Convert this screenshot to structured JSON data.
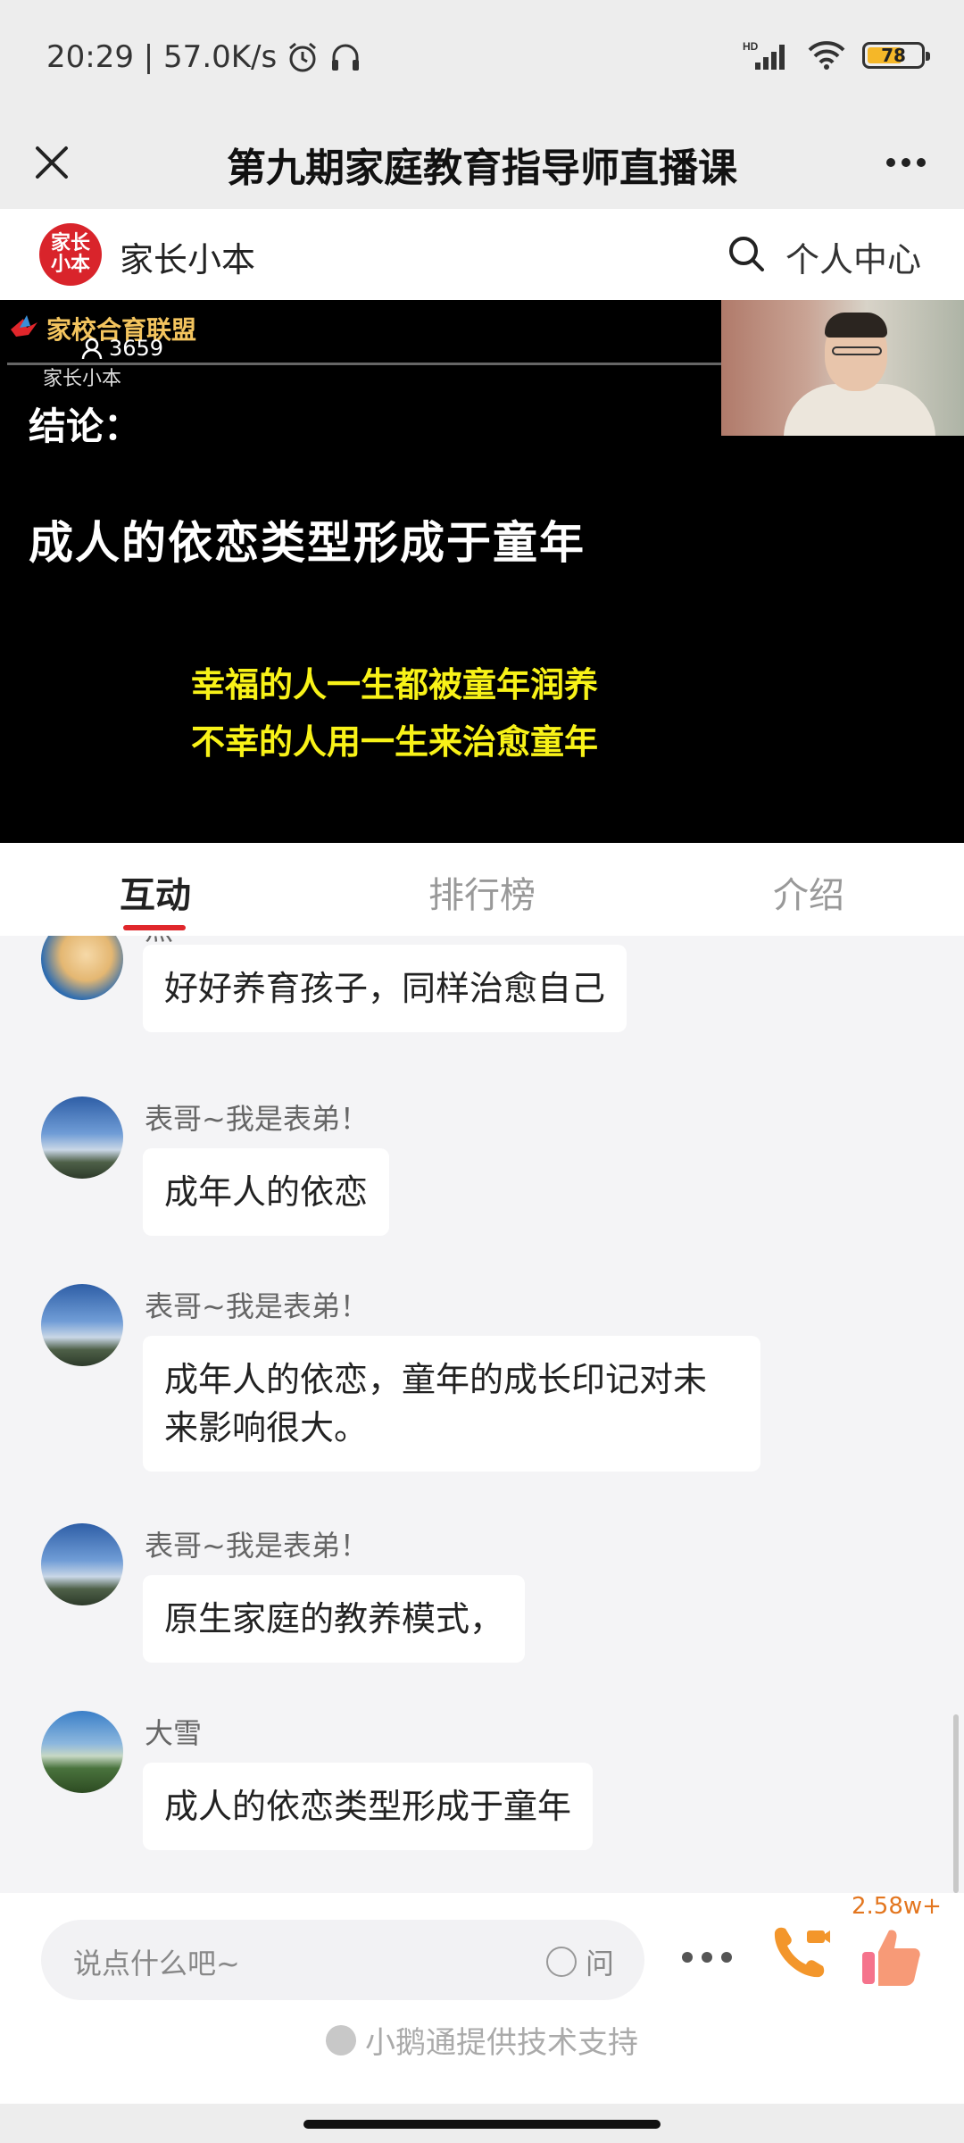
{
  "status_bar": {
    "time_speed": "20:29 | 57.0K/s",
    "network": "HD",
    "battery": "78",
    "icons": [
      "alarm-icon",
      "headphones-icon",
      "signal-icon",
      "wifi-icon",
      "battery-icon"
    ]
  },
  "title_bar": {
    "title": "第九期家庭教育指导师直播课"
  },
  "brand_bar": {
    "logo_text": "家长小本",
    "name": "家长小本",
    "personal_center": "个人中心"
  },
  "video": {
    "logo_text": "家校合育联盟",
    "viewer_count": "3659",
    "sub_logo": "家长小本",
    "slide_heading": "结论：",
    "slide_main": "成人的依恋类型形成于童年",
    "slide_line1": "幸福的人一生都被童年润养",
    "slide_line2": "不幸的人用一生来治愈童年"
  },
  "tabs": [
    {
      "label": "互动",
      "active": true
    },
    {
      "label": "排行榜",
      "active": false
    },
    {
      "label": "介绍",
      "active": false
    }
  ],
  "messages": [
    {
      "nick": "燕",
      "text": "好好养育孩子，同样治愈自己"
    },
    {
      "nick": "表哥~我是表弟！",
      "text": "成年人的依恋"
    },
    {
      "nick": "表哥~我是表弟！",
      "text": "成年人的依恋，童年的成长印记对未来影响很大。"
    },
    {
      "nick": "表哥~我是表弟！",
      "text": "原生家庭的教养模式，"
    },
    {
      "nick": "大雪",
      "text": "成人的依恋类型形成于童年"
    }
  ],
  "bottom_bar": {
    "input_placeholder": "说点什么吧~",
    "ask_label": "问",
    "like_count": "2.58w+",
    "powered_by": "小鹅通提供技术支持"
  },
  "colors": {
    "accent_red": "#e0262b",
    "slide_yellow": "#f8f218",
    "like_orange": "#e3761f"
  }
}
